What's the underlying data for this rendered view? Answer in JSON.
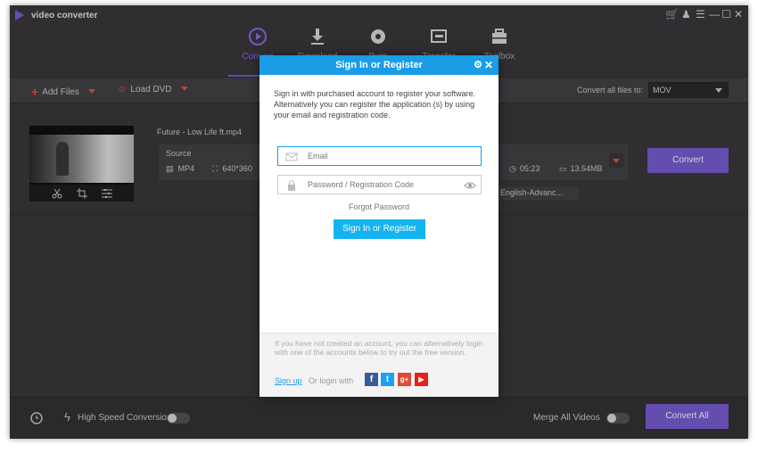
{
  "app": {
    "title": "video converter"
  },
  "window_controls": {
    "cart": "🛒",
    "user": "♟",
    "menu": "☰",
    "minimize": "—",
    "maximize": "☐",
    "close": "✕"
  },
  "nav": {
    "tabs": [
      {
        "label": "Convert",
        "icon": "convert-icon",
        "active": true
      },
      {
        "label": "Download",
        "icon": "download-icon"
      },
      {
        "label": "Burn",
        "icon": "burn-icon"
      },
      {
        "label": "Transfer",
        "icon": "transfer-icon"
      },
      {
        "label": "Toolbox",
        "icon": "toolbox-icon"
      }
    ]
  },
  "toolbar": {
    "add_files": "Add Files",
    "load_dvd": "Load DVD",
    "convert_all_label": "Convert all files to:",
    "format": "MOV"
  },
  "file": {
    "name": "Future - Low Life ft.mp4",
    "source_label": "Source",
    "source_format": "MP4",
    "source_resolution": "640*360",
    "duration": "05:23",
    "size": "13.54MB",
    "subtitle": "English-Advanc...",
    "convert_button": "Convert"
  },
  "bottom": {
    "high_speed": "High Speed Conversion",
    "merge": "Merge All Videos",
    "convert_all": "Convert All"
  },
  "dialog": {
    "title": "Sign In or Register",
    "intro": "Sign in with purchased account to register your software. Alternatively you can register the application (s) by using your email and registration code.",
    "email_placeholder": "Email",
    "password_placeholder": "Password / Registration Code",
    "forgot": "Forgot Password",
    "sign_button": "Sign In or Register",
    "alt_text": "If you have not created an account, you can alternatively login with one of the accounts below to try out the free version.",
    "signup": "Sign up",
    "or_login": "Or login with",
    "social": [
      {
        "letter": "f",
        "name": "facebook",
        "color": "#3b5998"
      },
      {
        "letter": "t",
        "name": "twitter",
        "color": "#1da1f2"
      },
      {
        "letter": "g+",
        "name": "google-plus",
        "color": "#dd4b39"
      },
      {
        "letter": "▶",
        "name": "youtube",
        "color": "#e62117"
      }
    ]
  },
  "colors": {
    "accent": "#7a5fd6",
    "dialog_header": "#1a9de6",
    "orange": "#e5553d"
  }
}
